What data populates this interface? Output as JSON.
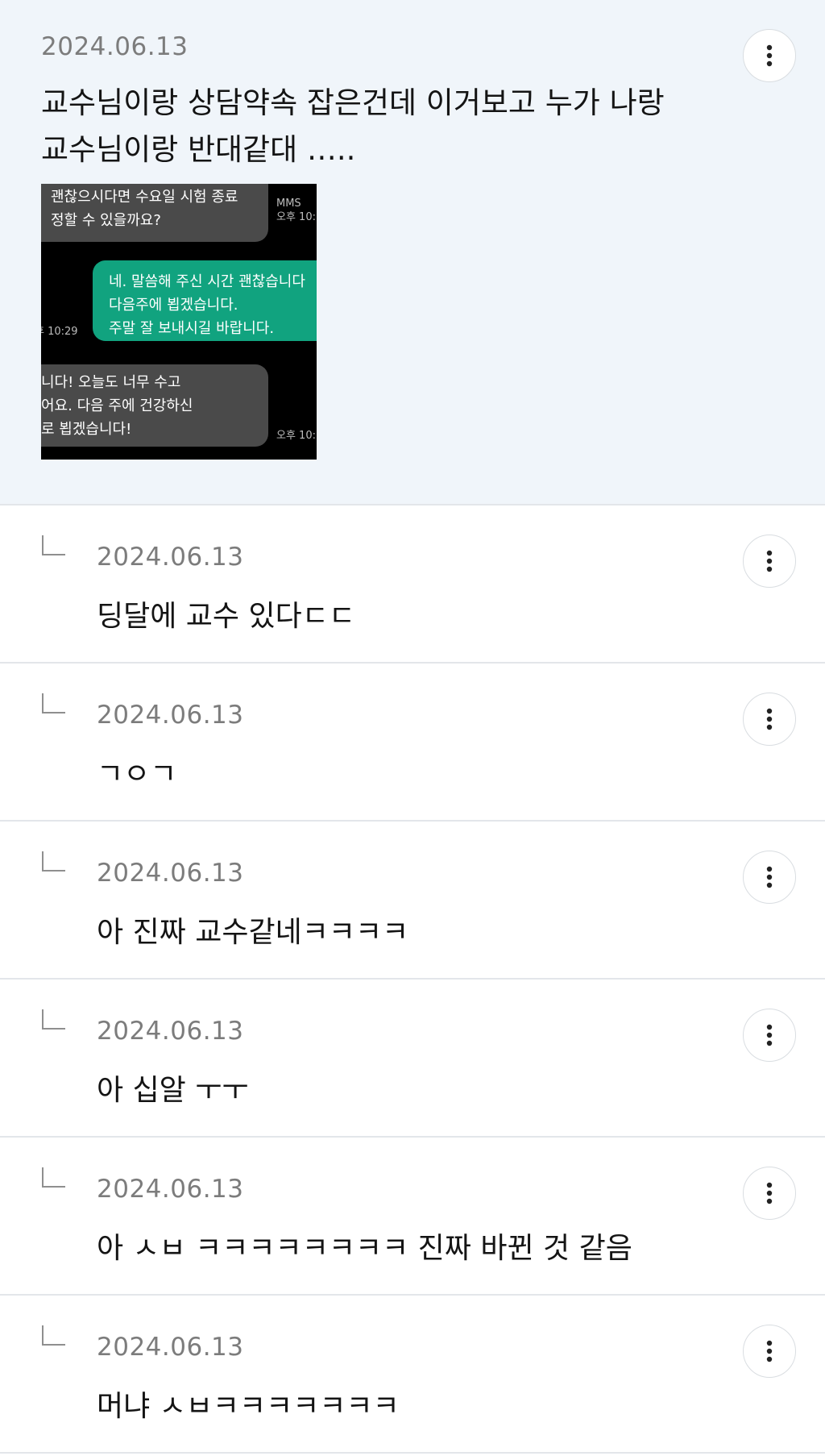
{
  "post": {
    "date": "2024.06.13",
    "text": "교수님이랑 상담약속 잡은건데 이거보고 누가 나랑\n교수님이랑 반대같대 …..",
    "attachment": {
      "bubble1": "괜찮으시다면 수요일 시험 종료\n정할 수 있을까요?",
      "meta1": "MMS\n오후 10:",
      "bubble2": "네. 말씀해 주신 시간 괜찮습니다\n다음주에 뵙겠습니다.\n주말 잘 보내시길 바랍니다.",
      "meta2": "후 10:29",
      "bubble3": "니다! 오늘도 너무 수고\n어요. 다음 주에 건강하신\n로 뵙겠습니다!",
      "meta3": "오후 10:"
    }
  },
  "replies": [
    {
      "date": "2024.06.13",
      "text": "딩달에 교수 있다ㄷㄷ"
    },
    {
      "date": "2024.06.13",
      "text": "ㄱㅇㄱ"
    },
    {
      "date": "2024.06.13",
      "text": "아 진짜 교수같네ㅋㅋㅋㅋ"
    },
    {
      "date": "2024.06.13",
      "text": "아 십알 ㅜㅜ"
    },
    {
      "date": "2024.06.13",
      "text": "아 ㅅㅂ ㅋㅋㅋㅋㅋㅋㅋㅋ 진짜 바뀐 것 같음"
    },
    {
      "date": "2024.06.13",
      "text": "머냐 ㅅㅂㅋㅋㅋㅋㅋㅋㅋ"
    }
  ],
  "icons": {
    "more": "more-vertical-icon",
    "reply": "reply-arrow-icon"
  },
  "colors": {
    "post_background": "#f0f5fa",
    "date_text": "#7c7c7c",
    "sent_bubble": "#11a37f",
    "received_bubble": "#4a4a4a"
  }
}
